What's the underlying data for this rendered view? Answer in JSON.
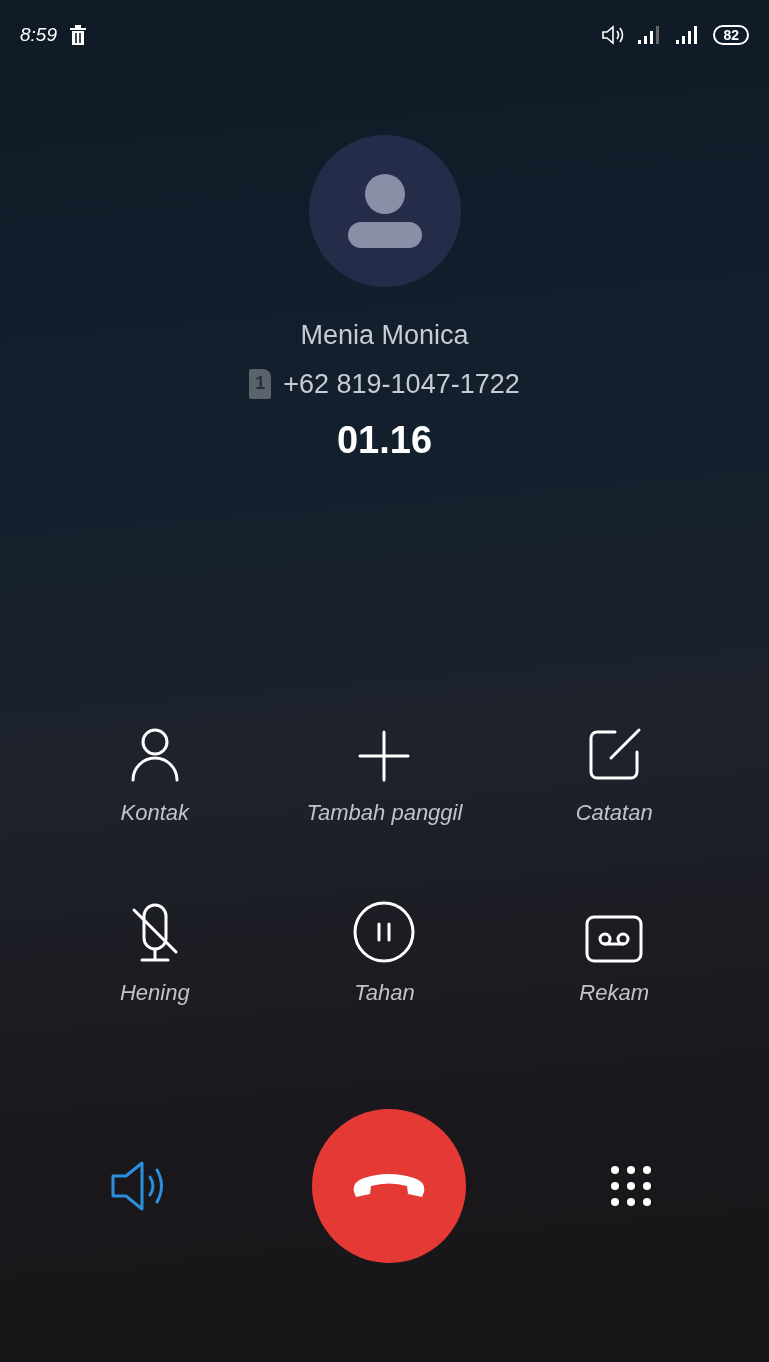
{
  "status_bar": {
    "time": "8:59",
    "battery": "82"
  },
  "caller": {
    "name": "Menia Monica",
    "sim": "1",
    "number": "+62 819-1047-1722",
    "duration": "01.16"
  },
  "controls": [
    {
      "kind": "contact",
      "label": "Kontak"
    },
    {
      "kind": "add",
      "label": "Tambah panggil"
    },
    {
      "kind": "note",
      "label": "Catatan"
    },
    {
      "kind": "mute",
      "label": "Hening"
    },
    {
      "kind": "hold",
      "label": "Tahan"
    },
    {
      "kind": "record",
      "label": "Rekam"
    }
  ],
  "speaker": {
    "on": true
  }
}
